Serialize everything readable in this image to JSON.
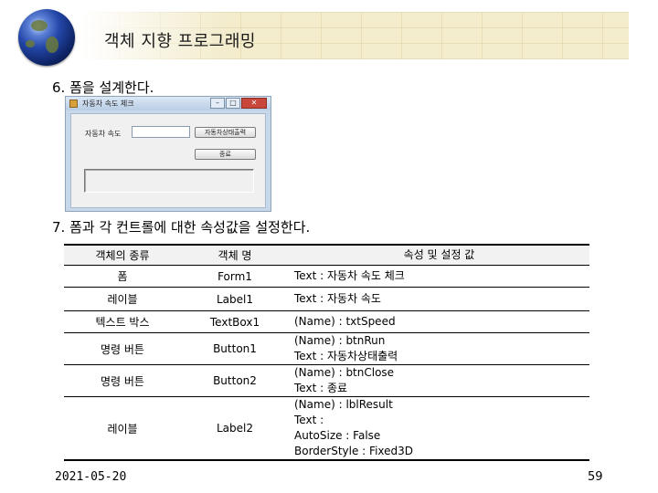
{
  "header": {
    "title": "객체 지향 프로그래밍"
  },
  "steps": {
    "step6": "6. 폼을 설계한다.",
    "step7": "7. 폼과 각 컨트롤에 대한 속성값을 설정한다."
  },
  "form_window": {
    "title": "자동차 속도 체크",
    "label": "자동차 속도",
    "btn_run": "자동차상태출력",
    "btn_close": "종료",
    "min": "–",
    "max": "□",
    "close": "✕"
  },
  "table": {
    "headers": [
      "객체의 종류",
      "객체 명",
      "속성 및 설정 값"
    ],
    "rows": [
      {
        "kind": "폼",
        "name": "Form1",
        "props": [
          "Text : 자동차 속도 체크"
        ]
      },
      {
        "kind": "레이블",
        "name": "Label1",
        "props": [
          "Text : 자동차 속도"
        ]
      },
      {
        "kind": "텍스트 박스",
        "name": "TextBox1",
        "props": [
          "(Name) : txtSpeed"
        ]
      },
      {
        "kind": "명령 버튼",
        "name": "Button1",
        "props": [
          "(Name) : btnRun",
          "Text : 자동차상태출력"
        ]
      },
      {
        "kind": "명령 버튼",
        "name": "Button2",
        "props": [
          "(Name) : btnClose",
          "Text : 종료"
        ]
      },
      {
        "kind": "레이블",
        "name": "Label2",
        "props": [
          "(Name) : lblResult",
          "Text :",
          "AutoSize : False",
          "BorderStyle : Fixed3D"
        ]
      }
    ]
  },
  "footer": {
    "date": "2021-05-20",
    "page": "59"
  }
}
